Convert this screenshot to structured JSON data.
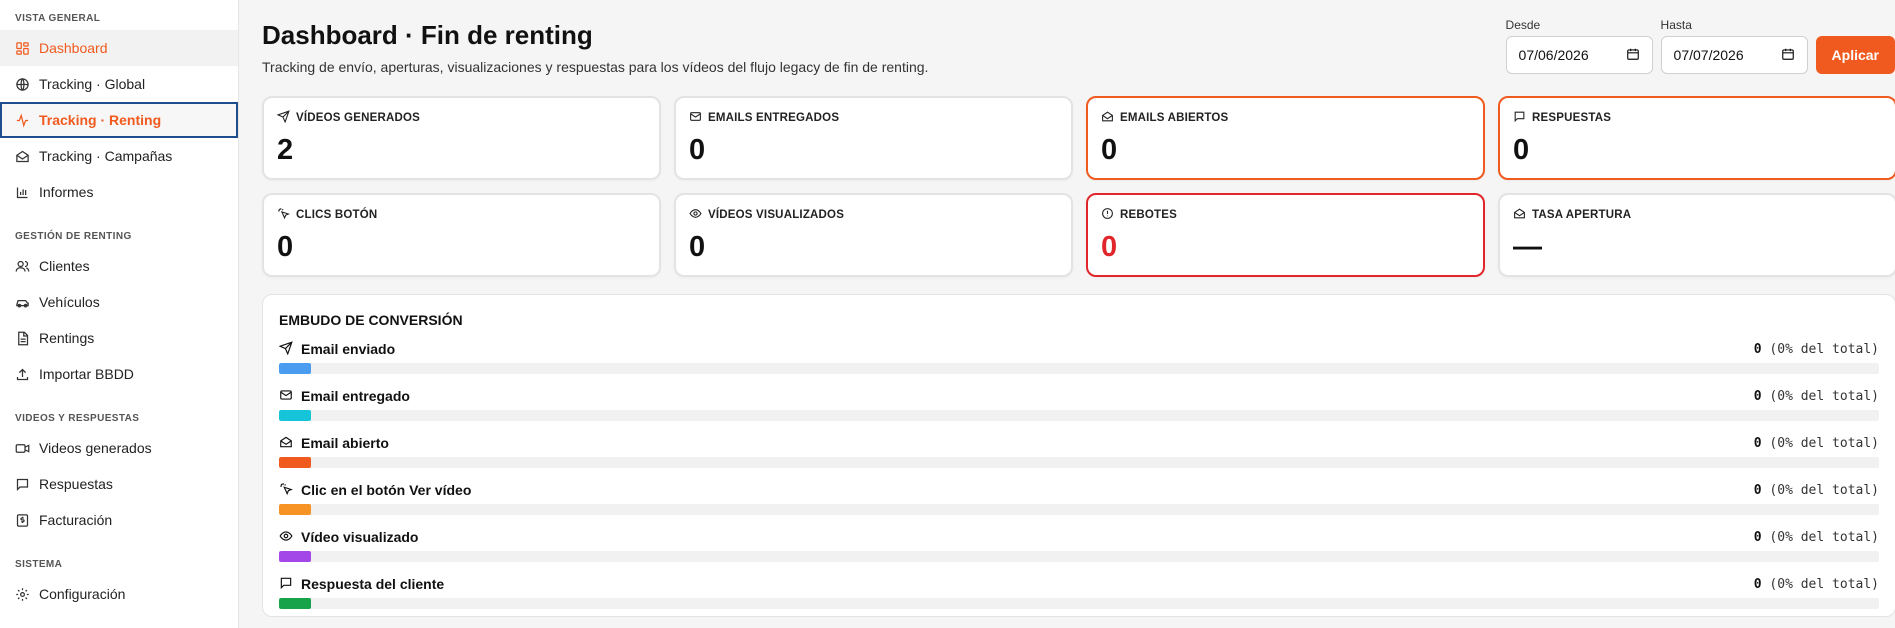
{
  "sidebar": {
    "sections": [
      {
        "title": "VISTA GENERAL",
        "items": [
          {
            "label": "Dashboard",
            "icon": "dashboard-icon"
          },
          {
            "label": "Tracking · Global",
            "icon": "globe-icon"
          },
          {
            "label": "Tracking · Renting",
            "icon": "activity-icon"
          },
          {
            "label": "Tracking · Campañas",
            "icon": "mail-open-icon"
          },
          {
            "label": "Informes",
            "icon": "bar-chart-icon"
          }
        ]
      },
      {
        "title": "GESTIÓN DE RENTING",
        "items": [
          {
            "label": "Clientes",
            "icon": "users-icon"
          },
          {
            "label": "Vehículos",
            "icon": "car-icon"
          },
          {
            "label": "Rentings",
            "icon": "document-icon"
          },
          {
            "label": "Importar BBDD",
            "icon": "upload-icon"
          }
        ]
      },
      {
        "title": "VIDEOS Y RESPUESTAS",
        "items": [
          {
            "label": "Videos generados",
            "icon": "video-icon"
          },
          {
            "label": "Respuestas",
            "icon": "message-icon"
          },
          {
            "label": "Facturación",
            "icon": "invoice-icon"
          }
        ]
      },
      {
        "title": "SISTEMA",
        "items": [
          {
            "label": "Configuración",
            "icon": "gear-icon"
          }
        ]
      }
    ]
  },
  "header": {
    "title": "Dashboard · Fin de renting",
    "subtitle": "Tracking de envío, aperturas, visualizaciones y respuestas para los vídeos del flujo legacy de fin de renting."
  },
  "filters": {
    "from_label": "Desde",
    "from_value": "07/06/2026",
    "to_label": "Hasta",
    "to_value": "07/07/2026",
    "apply_label": "Aplicar"
  },
  "cards": [
    {
      "label": "VÍDEOS GENERADOS",
      "value": "2",
      "icon": "send-icon",
      "accent": "none"
    },
    {
      "label": "EMAILS ENTREGADOS",
      "value": "0",
      "icon": "mail-icon",
      "accent": "none"
    },
    {
      "label": "EMAILS ABIERTOS",
      "value": "0",
      "icon": "mail-open-icon",
      "accent": "orange"
    },
    {
      "label": "RESPUESTAS",
      "value": "0",
      "icon": "message-icon",
      "accent": "orange"
    },
    {
      "label": "CLICS BOTÓN",
      "value": "0",
      "icon": "click-icon",
      "accent": "none"
    },
    {
      "label": "VÍDEOS VISUALIZADOS",
      "value": "0",
      "icon": "eye-icon",
      "accent": "none"
    },
    {
      "label": "REBOTES",
      "value": "0",
      "icon": "alert-icon",
      "accent": "red"
    },
    {
      "label": "TASA APERTURA",
      "value": "—",
      "icon": "mail-open-icon",
      "accent": "none"
    }
  ],
  "funnel": {
    "title": "EMBUDO DE CONVERSIÓN",
    "rows": [
      {
        "label": "Email enviado",
        "count": "0",
        "pct": "(0% del total)",
        "icon": "send-icon",
        "color": "#4a9cf0"
      },
      {
        "label": "Email entregado",
        "count": "0",
        "pct": "(0% del total)",
        "icon": "mail-icon",
        "color": "#16c4d9"
      },
      {
        "label": "Email abierto",
        "count": "0",
        "pct": "(0% del total)",
        "icon": "mail-open-icon",
        "color": "#f05a1e"
      },
      {
        "label": "Clic en el botón Ver vídeo",
        "count": "0",
        "pct": "(0% del total)",
        "icon": "click-icon",
        "color": "#f79324"
      },
      {
        "label": "Vídeo visualizado",
        "count": "0",
        "pct": "(0% del total)",
        "icon": "eye-icon",
        "color": "#a347e8"
      },
      {
        "label": "Respuesta del cliente",
        "count": "0",
        "pct": "(0% del total)",
        "icon": "message-icon",
        "color": "#16a34a"
      }
    ]
  },
  "colors": {
    "accent": "#f05a1e",
    "danger": "#e0262b",
    "focus": "#1f4e8c"
  }
}
